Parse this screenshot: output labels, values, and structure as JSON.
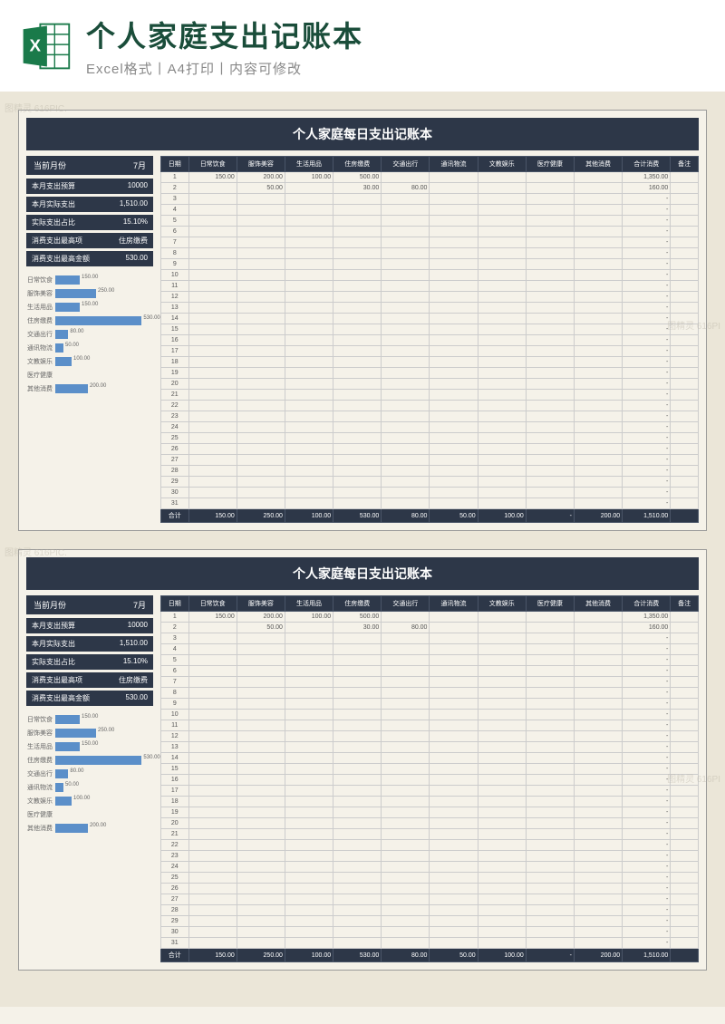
{
  "header": {
    "title": "个人家庭支出记账本",
    "subtitle": "Excel格式丨A4打印丨内容可修改"
  },
  "watermarks": [
    "图精灵 616PIC.",
    "图精灵 616PI"
  ],
  "sheet": {
    "title": "个人家庭每日支出记账本",
    "month": {
      "label": "当前月份",
      "value": "7月"
    },
    "summary": [
      {
        "label": "本月支出预算",
        "value": "10000"
      },
      {
        "label": "本月实际支出",
        "value": "1,510.00"
      },
      {
        "label": "实际支出占比",
        "value": "15.10%"
      },
      {
        "label": "消费支出最高项",
        "value": "住房缴费"
      },
      {
        "label": "消费支出最高金额",
        "value": "530.00"
      }
    ],
    "columns": [
      "日期",
      "日常饮食",
      "服饰美容",
      "生活用品",
      "住房缴费",
      "交通出行",
      "通讯物流",
      "文教娱乐",
      "医疗健康",
      "其他消费",
      "合计消费",
      "备注"
    ],
    "rows": [
      {
        "d": "1",
        "c": [
          "150.00",
          "200.00",
          "100.00",
          "500.00",
          "",
          "",
          "",
          "",
          "",
          "1,350.00",
          ""
        ]
      },
      {
        "d": "2",
        "c": [
          "",
          "50.00",
          "",
          "30.00",
          "80.00",
          "",
          "",
          "",
          "",
          "160.00",
          ""
        ]
      },
      {
        "d": "3",
        "c": [
          "",
          "",
          "",
          "",
          "",
          "",
          "",
          "",
          "",
          "-",
          ""
        ]
      },
      {
        "d": "4",
        "c": [
          "",
          "",
          "",
          "",
          "",
          "",
          "",
          "",
          "",
          "-",
          ""
        ]
      },
      {
        "d": "5",
        "c": [
          "",
          "",
          "",
          "",
          "",
          "",
          "",
          "",
          "",
          "-",
          ""
        ]
      },
      {
        "d": "6",
        "c": [
          "",
          "",
          "",
          "",
          "",
          "",
          "",
          "",
          "",
          "-",
          ""
        ]
      },
      {
        "d": "7",
        "c": [
          "",
          "",
          "",
          "",
          "",
          "",
          "",
          "",
          "",
          "-",
          ""
        ]
      },
      {
        "d": "8",
        "c": [
          "",
          "",
          "",
          "",
          "",
          "",
          "",
          "",
          "",
          "-",
          ""
        ]
      },
      {
        "d": "9",
        "c": [
          "",
          "",
          "",
          "",
          "",
          "",
          "",
          "",
          "",
          "-",
          ""
        ]
      },
      {
        "d": "10",
        "c": [
          "",
          "",
          "",
          "",
          "",
          "",
          "",
          "",
          "",
          "-",
          ""
        ]
      },
      {
        "d": "11",
        "c": [
          "",
          "",
          "",
          "",
          "",
          "",
          "",
          "",
          "",
          "-",
          ""
        ]
      },
      {
        "d": "12",
        "c": [
          "",
          "",
          "",
          "",
          "",
          "",
          "",
          "",
          "",
          "-",
          ""
        ]
      },
      {
        "d": "13",
        "c": [
          "",
          "",
          "",
          "",
          "",
          "",
          "",
          "",
          "",
          "-",
          ""
        ]
      },
      {
        "d": "14",
        "c": [
          "",
          "",
          "",
          "",
          "",
          "",
          "",
          "",
          "",
          "-",
          ""
        ]
      },
      {
        "d": "15",
        "c": [
          "",
          "",
          "",
          "",
          "",
          "",
          "",
          "",
          "",
          "-",
          ""
        ]
      },
      {
        "d": "16",
        "c": [
          "",
          "",
          "",
          "",
          "",
          "",
          "",
          "",
          "",
          "-",
          ""
        ]
      },
      {
        "d": "17",
        "c": [
          "",
          "",
          "",
          "",
          "",
          "",
          "",
          "",
          "",
          "-",
          ""
        ]
      },
      {
        "d": "18",
        "c": [
          "",
          "",
          "",
          "",
          "",
          "",
          "",
          "",
          "",
          "-",
          ""
        ]
      },
      {
        "d": "19",
        "c": [
          "",
          "",
          "",
          "",
          "",
          "",
          "",
          "",
          "",
          "-",
          ""
        ]
      },
      {
        "d": "20",
        "c": [
          "",
          "",
          "",
          "",
          "",
          "",
          "",
          "",
          "",
          "-",
          ""
        ]
      },
      {
        "d": "21",
        "c": [
          "",
          "",
          "",
          "",
          "",
          "",
          "",
          "",
          "",
          "-",
          ""
        ]
      },
      {
        "d": "22",
        "c": [
          "",
          "",
          "",
          "",
          "",
          "",
          "",
          "",
          "",
          "-",
          ""
        ]
      },
      {
        "d": "23",
        "c": [
          "",
          "",
          "",
          "",
          "",
          "",
          "",
          "",
          "",
          "-",
          ""
        ]
      },
      {
        "d": "24",
        "c": [
          "",
          "",
          "",
          "",
          "",
          "",
          "",
          "",
          "",
          "-",
          ""
        ]
      },
      {
        "d": "25",
        "c": [
          "",
          "",
          "",
          "",
          "",
          "",
          "",
          "",
          "",
          "-",
          ""
        ]
      },
      {
        "d": "26",
        "c": [
          "",
          "",
          "",
          "",
          "",
          "",
          "",
          "",
          "",
          "-",
          ""
        ]
      },
      {
        "d": "27",
        "c": [
          "",
          "",
          "",
          "",
          "",
          "",
          "",
          "",
          "",
          "-",
          ""
        ]
      },
      {
        "d": "28",
        "c": [
          "",
          "",
          "",
          "",
          "",
          "",
          "",
          "",
          "",
          "-",
          ""
        ]
      },
      {
        "d": "29",
        "c": [
          "",
          "",
          "",
          "",
          "",
          "",
          "",
          "",
          "",
          "-",
          ""
        ]
      },
      {
        "d": "30",
        "c": [
          "",
          "",
          "",
          "",
          "",
          "",
          "",
          "",
          "",
          "-",
          ""
        ]
      },
      {
        "d": "31",
        "c": [
          "",
          "",
          "",
          "",
          "",
          "",
          "",
          "",
          "",
          "-",
          ""
        ]
      }
    ],
    "total": {
      "label": "合计",
      "c": [
        "150.00",
        "250.00",
        "100.00",
        "530.00",
        "80.00",
        "50.00",
        "100.00",
        "-",
        "200.00",
        "1,510.00",
        ""
      ]
    }
  },
  "chart_data": {
    "type": "bar",
    "title": "",
    "categories": [
      "日常饮食",
      "服饰美容",
      "生活用品",
      "住房缴费",
      "交通出行",
      "通讯物流",
      "文教娱乐",
      "医疗健康",
      "其他消费"
    ],
    "values": [
      150,
      250,
      150,
      530,
      80,
      50,
      100,
      0,
      200
    ],
    "display_values": [
      "150.00",
      "250.00",
      "150.00",
      "530.00",
      "80.00",
      "50.00",
      "100.00",
      "",
      "200.00"
    ],
    "xlabel": "",
    "ylabel": "",
    "xlim": [
      0,
      600
    ]
  }
}
